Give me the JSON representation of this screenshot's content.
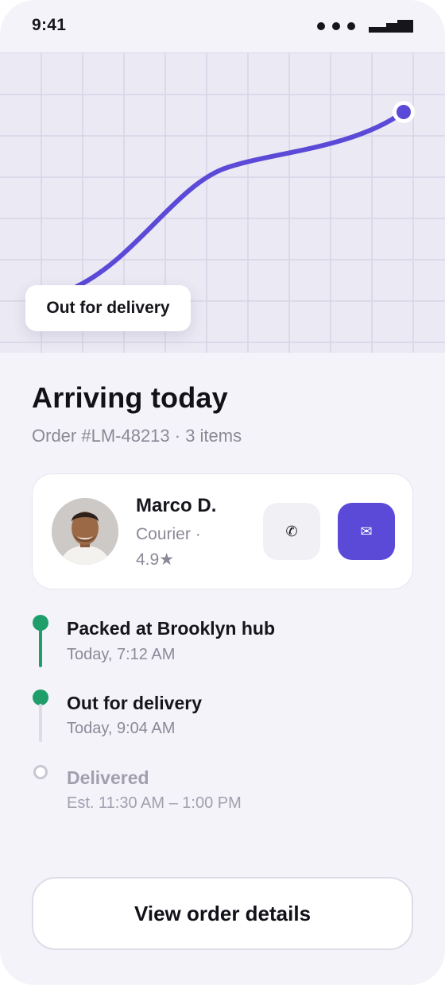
{
  "status_bar": {
    "time": "9:41"
  },
  "map": {
    "chip_label": "Out for delivery",
    "route_color": "#5b4ad7",
    "marker_color": "#5b4ad7"
  },
  "header": {
    "title": "Arriving today",
    "subtitle": "Order #LM-48213 · 3 items"
  },
  "courier": {
    "name": "Marco D.",
    "role": "Courier ·",
    "rating": "4.9★",
    "call_icon": "✆",
    "message_icon": "✉"
  },
  "timeline": [
    {
      "title": "Packed at Brooklyn hub",
      "time": "Today, 7:12 AM",
      "state": "done"
    },
    {
      "title": "Out for delivery",
      "time": "Today, 9:04 AM",
      "state": "done"
    },
    {
      "title": "Delivered",
      "time": "Est. 11:30 AM – 1:00 PM",
      "state": "pending"
    }
  ],
  "actions": {
    "view_details": "View order details"
  },
  "colors": {
    "accent": "#5b4ad7",
    "success": "#1f9e6a",
    "background": "#f4f3f9"
  }
}
